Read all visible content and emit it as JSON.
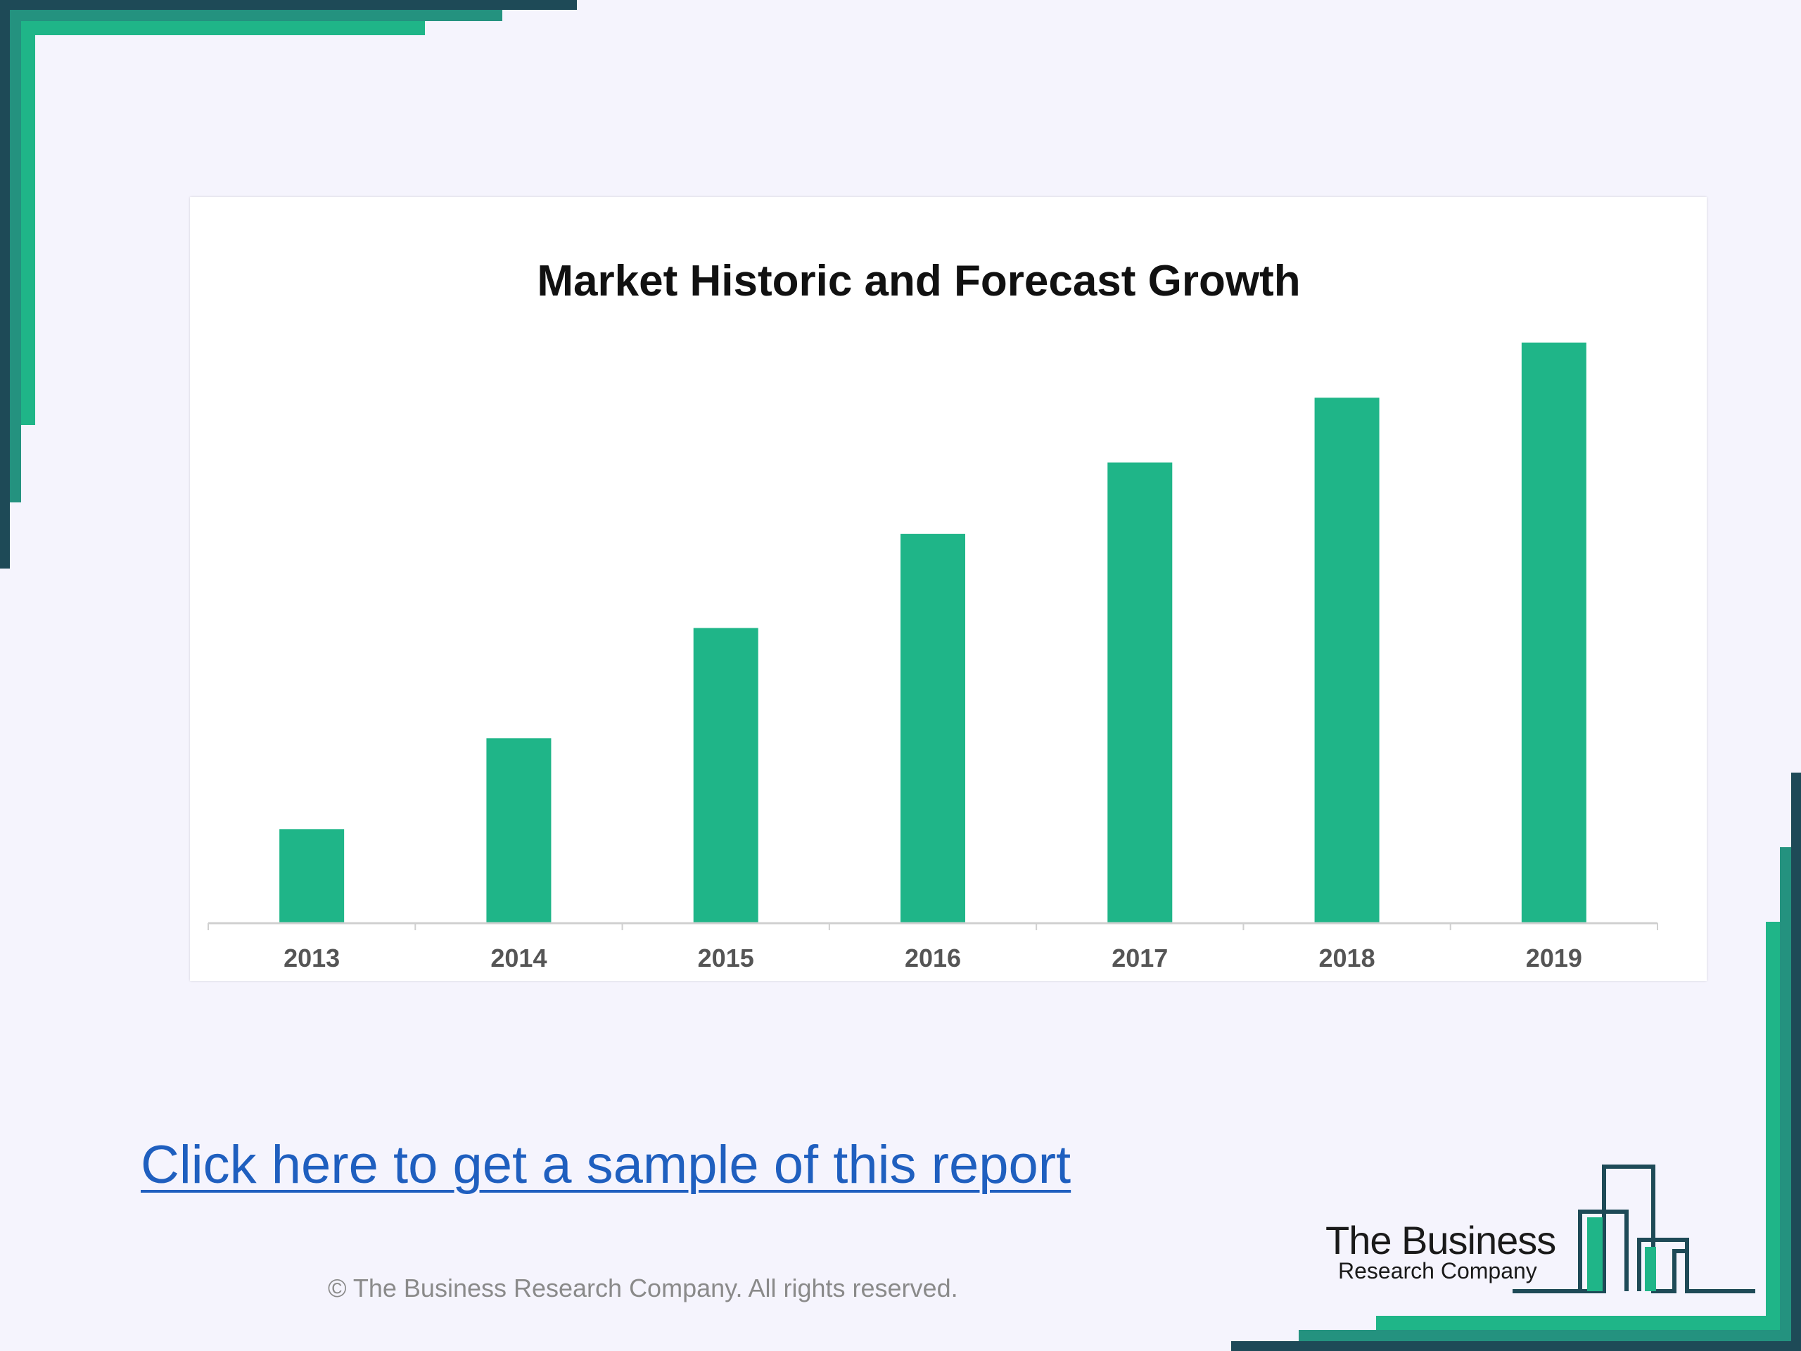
{
  "chart_data": {
    "type": "bar",
    "title": "Market Historic and Forecast Growth",
    "categories": [
      "2013",
      "2014",
      "2015",
      "2016",
      "2017",
      "2018",
      "2019"
    ],
    "values": [
      14.5,
      28.5,
      45.5,
      60,
      71,
      81,
      89.5
    ],
    "ylim": [
      0,
      100
    ],
    "xlabel": "",
    "ylabel": "",
    "grid": false,
    "legend": "none",
    "bar_color": "#1fb588"
  },
  "link": {
    "label": "Click here to get a sample of this report"
  },
  "footer": {
    "copyright": "© The Business Research Company. All rights reserved."
  },
  "logo": {
    "line1": "The Business",
    "line2": "Research Company"
  },
  "colors": {
    "background": "#f5f4fd",
    "accent_dark": "#1e4a57",
    "accent_teal": "#24927f",
    "accent_green": "#1fb588",
    "link": "#1f5fbf"
  }
}
